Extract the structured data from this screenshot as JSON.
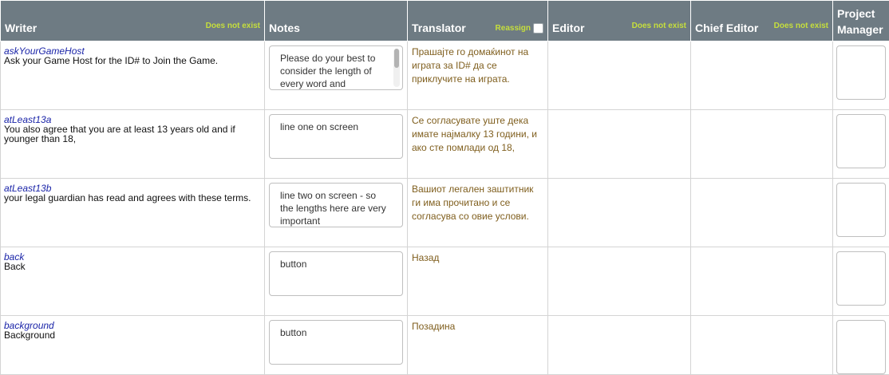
{
  "headers": {
    "writer": {
      "label": "Writer",
      "status": "Does not exist"
    },
    "notes": {
      "label": "Notes"
    },
    "translator": {
      "label": "Translator",
      "reassign": "Reassign"
    },
    "editor": {
      "label": "Editor",
      "status": "Does not exist"
    },
    "chief_editor": {
      "label": "Chief Editor",
      "status": "Does not exist"
    },
    "project_manager": {
      "line1": "Project",
      "line2": "Manager"
    }
  },
  "rows": [
    {
      "key": "askYourGameHost",
      "english": "Ask your Game Host for the ID# to Join the Game.",
      "note": "Please do your best to consider the length of every word and",
      "translation": "Прашајте го домаќинот на играта за ID# да се приклучите на играта."
    },
    {
      "key": "atLeast13a",
      "english": "You also agree that you are at least 13 years old and if younger than 18,",
      "note": "line one on screen",
      "translation": "Се согласувате уште дека имате најмалку 13 години, и ако сте помлади од 18,"
    },
    {
      "key": "atLeast13b",
      "english": "your legal guardian has read and agrees with these terms.",
      "note": "line two on screen - so the lengths here are very important",
      "translation": "Вашиот легален заштитник ги има прочитано и се согласува со овие услови."
    },
    {
      "key": "back",
      "english": "Back",
      "note": "button",
      "translation": "Назад"
    },
    {
      "key": "background",
      "english": "Background",
      "note": "button",
      "translation": "Позадина"
    }
  ],
  "colors": {
    "header_bg": "#6e7b83",
    "status_text": "#c6df3c",
    "key_text": "#1a24a8",
    "translation_text": "#7f5e1d"
  }
}
